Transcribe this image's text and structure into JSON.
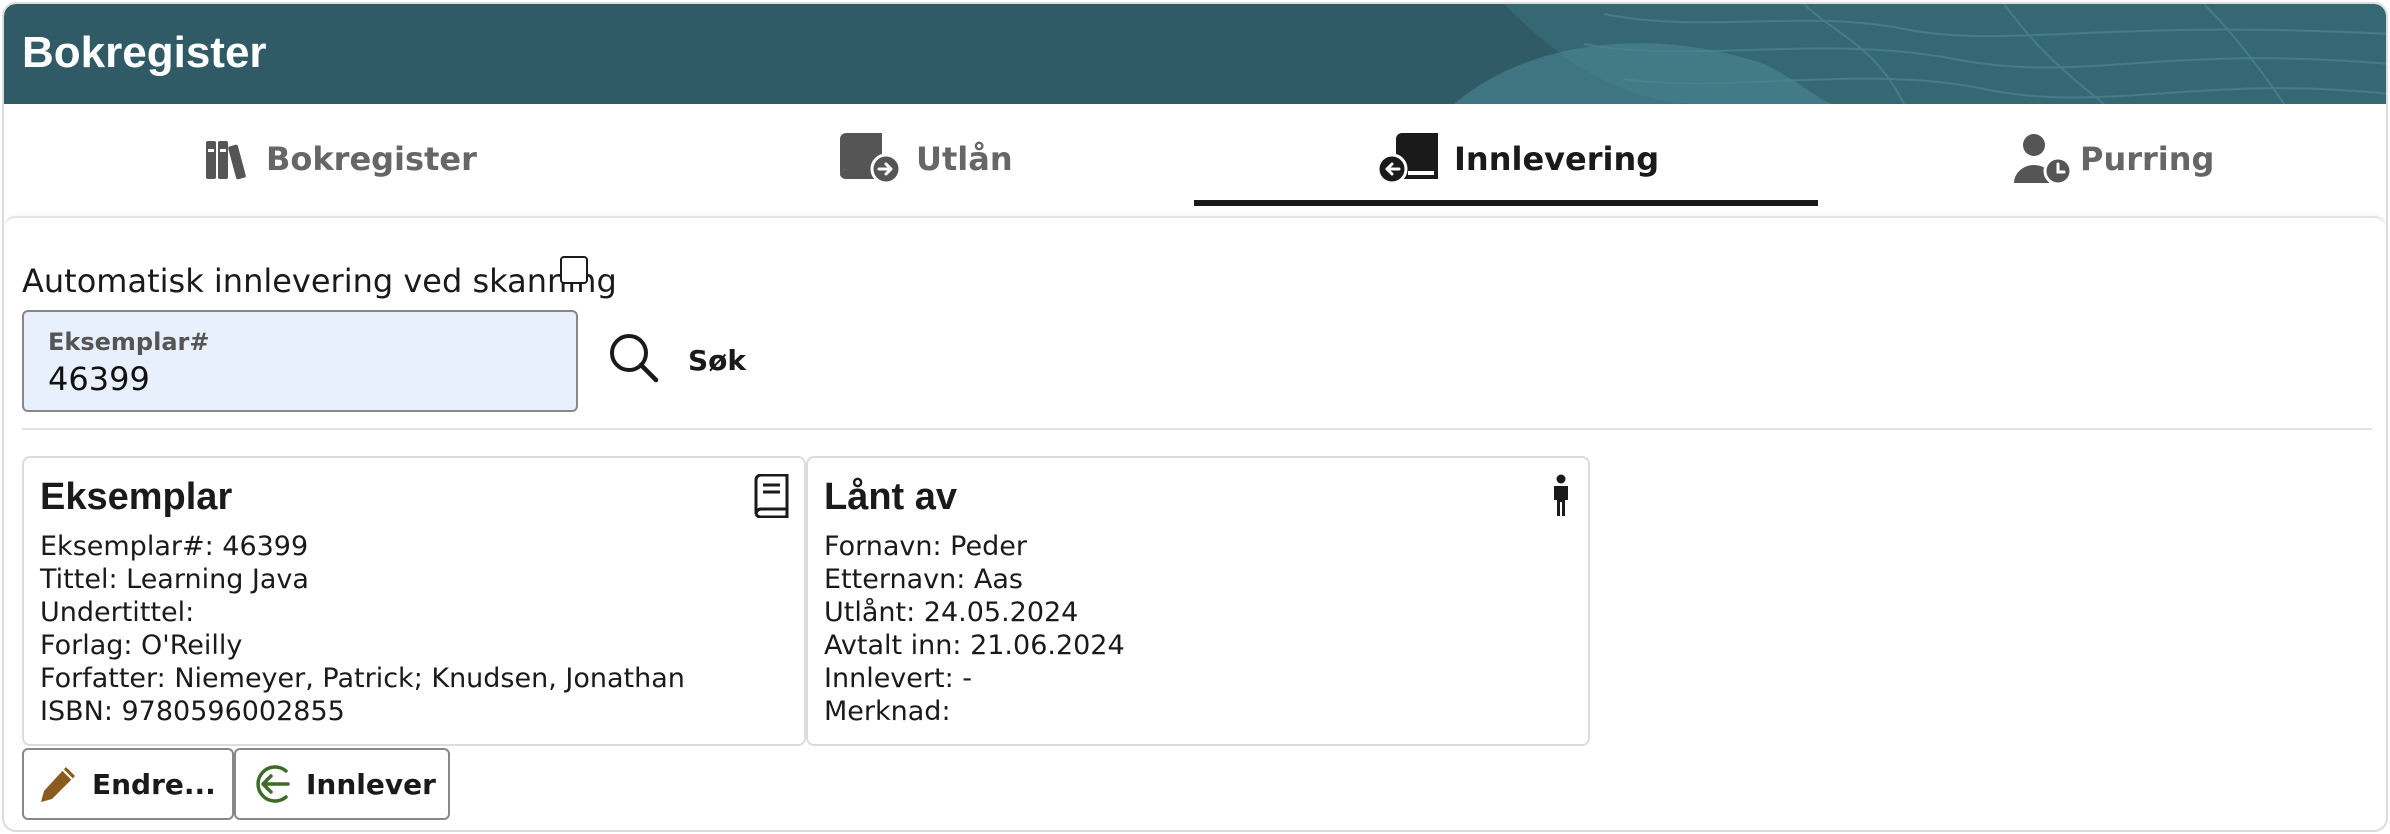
{
  "header": {
    "title": "Bokregister"
  },
  "tabs": [
    {
      "label": "Bokregister",
      "icon": "books-icon"
    },
    {
      "label": "Utlån",
      "icon": "book-out-icon"
    },
    {
      "label": "Innlevering",
      "icon": "book-return-icon",
      "active": true
    },
    {
      "label": "Purring",
      "icon": "user-clock-icon"
    }
  ],
  "auto_return": {
    "label": "Automatisk innlevering ved skanning",
    "checked": false
  },
  "search": {
    "field_label": "Eksemplar#",
    "value": "46399",
    "button_label": "Søk"
  },
  "copy_card": {
    "title": "Eksemplar",
    "lines": [
      "Eksemplar#: 46399",
      "Tittel: Learning Java",
      "Undertittel:",
      "Forlag: O'Reilly",
      "Forfatter: Niemeyer, Patrick; Knudsen, Jonathan",
      "ISBN: 9780596002855"
    ]
  },
  "loan_card": {
    "title": "Lånt av",
    "lines": [
      "Fornavn: Peder",
      "Etternavn: Aas",
      "Utlånt: 24.05.2024",
      "Avtalt inn: 21.06.2024",
      "Innlevert: -",
      "Merknad:"
    ]
  },
  "actions": {
    "edit_label": "Endre...",
    "return_label": "Innlever"
  },
  "colors": {
    "header_bg": "#2f5a66",
    "edit_icon": "#8a5a1e",
    "return_icon": "#3f6b2a",
    "field_bg": "#e8effd"
  }
}
